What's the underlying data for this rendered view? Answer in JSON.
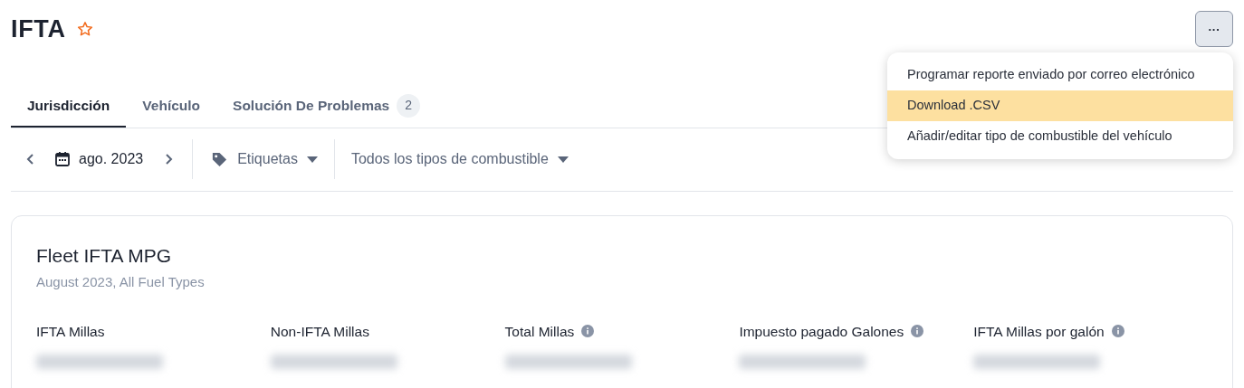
{
  "header": {
    "title": "IFTA",
    "favorite": false,
    "more_button": "···"
  },
  "menu": {
    "items": [
      {
        "label": "Programar reporte enviado por correo electrónico",
        "selected": false
      },
      {
        "label": "Download .CSV",
        "selected": true
      },
      {
        "label": "Añadir/editar tipo de combustible del vehículo",
        "selected": false
      }
    ]
  },
  "tabs": [
    {
      "label": "Jurisdicción",
      "selected": true
    },
    {
      "label": "Vehículo",
      "selected": false
    },
    {
      "label": "Solución De Problemas",
      "selected": false,
      "count": "2"
    }
  ],
  "filters": {
    "date": "ago. 2023",
    "tags": "Etiquetas",
    "fuel": "Todos los tipos de combustible"
  },
  "card": {
    "title": "Fleet IFTA MPG",
    "subtitle": "August 2023, All Fuel Types",
    "metrics": [
      {
        "label": "IFTA Millas",
        "info": false
      },
      {
        "label": "Non-IFTA Millas",
        "info": false
      },
      {
        "label": "Total Millas",
        "info": true
      },
      {
        "label": "Impuesto pagado Galones",
        "info": true
      },
      {
        "label": "IFTA Millas por galón",
        "info": true
      }
    ]
  }
}
